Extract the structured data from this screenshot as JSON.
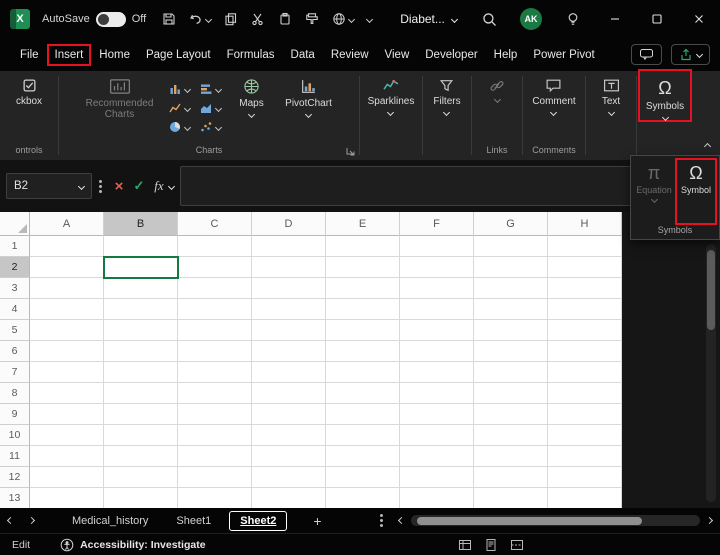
{
  "titlebar": {
    "logo_glyph": "X",
    "autosave_label": "AutoSave",
    "autosave_state": "Off",
    "document_title": "Diabet...",
    "avatar_initials": "AK"
  },
  "menubar": {
    "tabs": [
      {
        "label": "File"
      },
      {
        "label": "Insert"
      },
      {
        "label": "Home"
      },
      {
        "label": "Page Layout"
      },
      {
        "label": "Formulas"
      },
      {
        "label": "Data"
      },
      {
        "label": "Review"
      },
      {
        "label": "View"
      },
      {
        "label": "Developer"
      },
      {
        "label": "Help"
      },
      {
        "label": "Power Pivot"
      }
    ]
  },
  "ribbon": {
    "controls_group": {
      "button_label": "ckbox",
      "group_label": "ontrols"
    },
    "charts_group": {
      "recommended_label": "Recommended Charts",
      "maps_label": "Maps",
      "pivotchart_label": "PivotChart",
      "group_label": "Charts"
    },
    "sparklines_label": "Sparklines",
    "filters_label": "Filters",
    "links_group_label": "Links",
    "comments_group": {
      "button_label": "Comment",
      "group_label": "Comments"
    },
    "text_label": "Text",
    "symbols_label": "Symbols"
  },
  "symbols_flyout": {
    "equation_label": "Equation",
    "symbol_label": "Symbol",
    "group_label": "Symbols"
  },
  "formula_bar": {
    "name_box_value": "B2",
    "cancel_glyph": "×",
    "enter_glyph": "✓",
    "fx_label": "fx",
    "formula_value": ""
  },
  "grid": {
    "columns": [
      "A",
      "B",
      "C",
      "D",
      "E",
      "F",
      "G",
      "H"
    ],
    "rows": [
      "1",
      "2",
      "3",
      "4",
      "5",
      "6",
      "7",
      "8",
      "9",
      "10",
      "11",
      "12",
      "13"
    ],
    "selected_column": "B",
    "selected_row": "2",
    "selected_cell": "B2"
  },
  "sheet_tabs": {
    "tabs": [
      {
        "label": "Medical_history",
        "active": false
      },
      {
        "label": "Sheet1",
        "active": false
      },
      {
        "label": "Sheet2",
        "active": true
      }
    ],
    "add_label": "+"
  },
  "status_bar": {
    "mode": "Edit",
    "accessibility_text": "Accessibility: Investigate"
  },
  "icons": {
    "omega": "Ω",
    "equation_pi": "π"
  },
  "annotations": {
    "color": "#E81123",
    "targets": [
      "insert-tab",
      "symbols-button",
      "symbol-menu-item"
    ]
  }
}
